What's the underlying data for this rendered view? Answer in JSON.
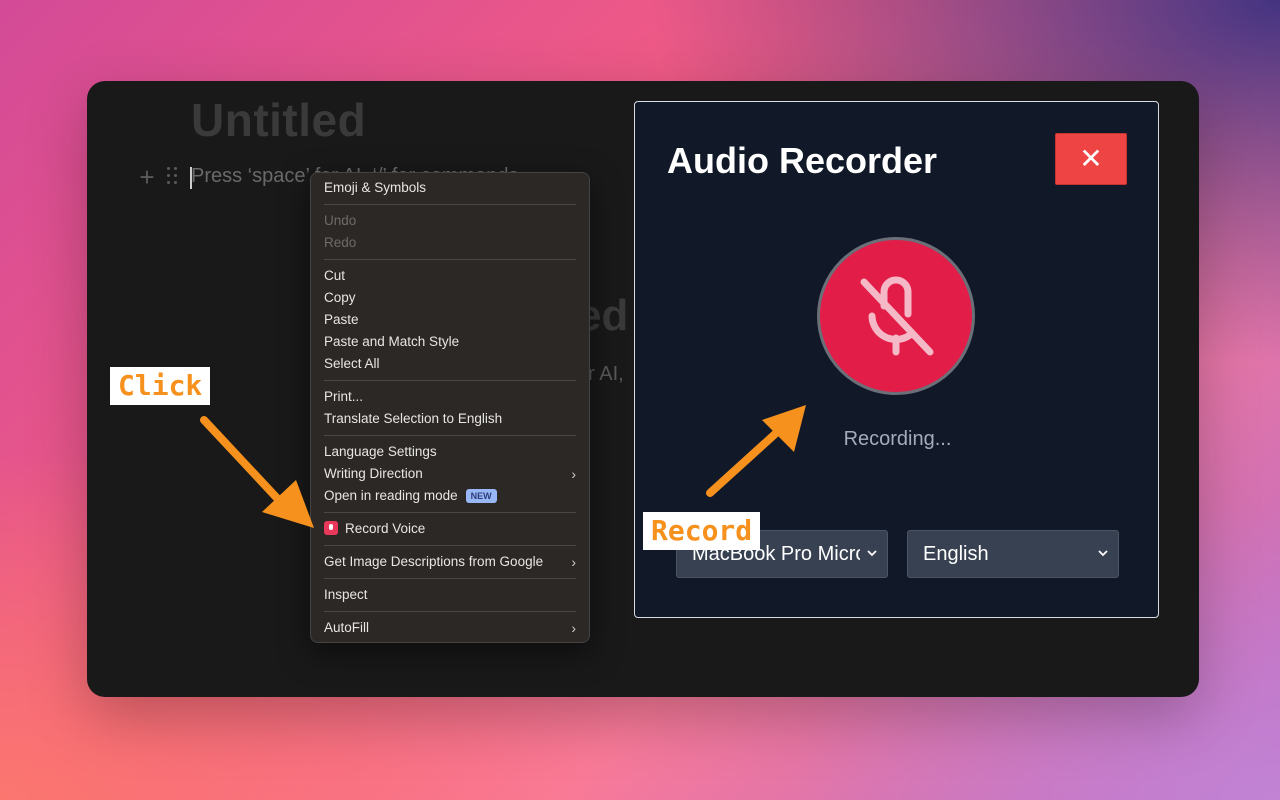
{
  "editor": {
    "page_title": "Untitled",
    "placeholder": "Press ‘space’ for AI, ‘/’ for commands…",
    "bg_fragment_a": "ed",
    "bg_fragment_b": "or AI,"
  },
  "context_menu": {
    "emoji": "Emoji & Symbols",
    "undo": "Undo",
    "redo": "Redo",
    "cut": "Cut",
    "copy": "Copy",
    "paste": "Paste",
    "paste_match": "Paste and Match Style",
    "select_all": "Select All",
    "print": "Print...",
    "translate": "Translate Selection to English",
    "language_settings": "Language Settings",
    "writing_direction": "Writing Direction",
    "reading_mode": "Open in reading mode",
    "new_badge": "NEW",
    "record_voice": "Record Voice",
    "image_descriptions": "Get Image Descriptions from Google",
    "inspect": "Inspect",
    "autofill": "AutoFill"
  },
  "recorder": {
    "title": "Audio Recorder",
    "close_glyph": "✕",
    "status": "Recording...",
    "device_selected": "MacBook Pro Microphone",
    "language_selected": "English"
  },
  "annotations": {
    "click": "Click",
    "record": "Record"
  },
  "colors": {
    "accent_orange": "#f6911e",
    "mic_red": "#e11d48",
    "close_red": "#ef4444",
    "panel_bg": "#111827"
  },
  "icons": {
    "plus": "plus-icon",
    "drag": "drag-handle-icon",
    "mic_off": "microphone-off-icon",
    "close": "close-icon",
    "chevron": "chevron-down-icon",
    "submenu": "chevron-right-icon"
  }
}
